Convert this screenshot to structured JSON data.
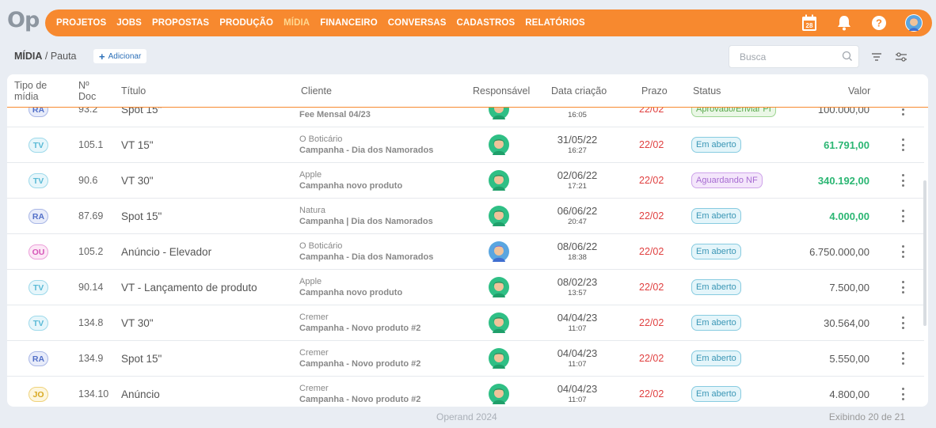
{
  "logo": "Op",
  "nav": {
    "items": [
      {
        "label": "PROJETOS",
        "active": false
      },
      {
        "label": "JOBS",
        "active": false
      },
      {
        "label": "PROPOSTAS",
        "active": false
      },
      {
        "label": "PRODUÇÃO",
        "active": false
      },
      {
        "label": "MÍDIA",
        "active": true
      },
      {
        "label": "FINANCEIRO",
        "active": false
      },
      {
        "label": "CONVERSAS",
        "active": false
      },
      {
        "label": "CADASTROS",
        "active": false
      },
      {
        "label": "RELATÓRIOS",
        "active": false
      }
    ],
    "calendar_day": "28",
    "accent": "#f7892f"
  },
  "breadcrumb": {
    "section": "MÍDIA",
    "separator": " / ",
    "page": "Pauta"
  },
  "add_button": "Adicionar",
  "search": {
    "placeholder": "Busca"
  },
  "table": {
    "headers": {
      "tipo_1": "Tipo de",
      "tipo_2": "mídia",
      "doc_1": "Nº",
      "doc_2": "Doc",
      "titulo": "Título",
      "cliente": "Cliente",
      "responsavel": "Responsável",
      "data": "Data criação",
      "prazo": "Prazo",
      "status": "Status",
      "valor": "Valor"
    },
    "rows": [
      {
        "type": "RA",
        "doc": "93.2",
        "title": "Spot 15\"",
        "client": "",
        "campaign": "Fee Mensal 04/23",
        "date": "",
        "time": "16:05",
        "prazo": "22/02",
        "status": "Aprovado/Enviar PI",
        "status_kind": "aprov",
        "value": "100.000,00",
        "green": false
      },
      {
        "type": "TV",
        "doc": "105.1",
        "title": "VT 15\"",
        "client": "O Boticário",
        "campaign": "Campanha - Dia dos Namorados",
        "date": "31/05/22",
        "time": "16:27",
        "prazo": "22/02",
        "status": "Em aberto",
        "status_kind": "aberto",
        "value": "61.791,00",
        "green": true
      },
      {
        "type": "TV",
        "doc": "90.6",
        "title": "VT 30\"",
        "client": "Apple",
        "campaign": "Campanha novo produto",
        "date": "02/06/22",
        "time": "17:21",
        "prazo": "22/02",
        "status": "Aguardando NF",
        "status_kind": "nf",
        "value": "340.192,00",
        "green": true
      },
      {
        "type": "RA",
        "doc": "87.69",
        "title": "Spot 15\"",
        "client": "Natura",
        "campaign": "Campanha | Dia dos Namorados",
        "date": "06/06/22",
        "time": "20:47",
        "prazo": "22/02",
        "status": "Em aberto",
        "status_kind": "aberto",
        "value": "4.000,00",
        "green": true
      },
      {
        "type": "OU",
        "doc": "105.2",
        "title": "Anúncio - Elevador",
        "client": "O Boticário",
        "campaign": "Campanha - Dia dos Namorados",
        "date": "08/06/22",
        "time": "18:38",
        "prazo": "22/02",
        "status": "Em aberto",
        "status_kind": "aberto",
        "value": "6.750.000,00",
        "green": false,
        "avatar": "blue"
      },
      {
        "type": "TV",
        "doc": "90.14",
        "title": "VT - Lançamento de produto",
        "client": "Apple",
        "campaign": "Campanha novo produto",
        "date": "08/02/23",
        "time": "13:57",
        "prazo": "22/02",
        "status": "Em aberto",
        "status_kind": "aberto",
        "value": "7.500,00",
        "green": false
      },
      {
        "type": "TV",
        "doc": "134.8",
        "title": "VT 30\"",
        "client": "Cremer",
        "campaign": "Campanha - Novo produto #2",
        "date": "04/04/23",
        "time": "11:07",
        "prazo": "22/02",
        "status": "Em aberto",
        "status_kind": "aberto",
        "value": "30.564,00",
        "green": false
      },
      {
        "type": "RA",
        "doc": "134.9",
        "title": "Spot 15\"",
        "client": "Cremer",
        "campaign": "Campanha - Novo produto #2",
        "date": "04/04/23",
        "time": "11:07",
        "prazo": "22/02",
        "status": "Em aberto",
        "status_kind": "aberto",
        "value": "5.550,00",
        "green": false
      },
      {
        "type": "JO",
        "doc": "134.10",
        "title": "Anúncio",
        "client": "Cremer",
        "campaign": "Campanha - Novo produto #2",
        "date": "04/04/23",
        "time": "11:07",
        "prazo": "22/02",
        "status": "Em aberto",
        "status_kind": "aberto",
        "value": "4.800,00",
        "green": false
      }
    ]
  },
  "footer": {
    "center": "Operand 2024",
    "right": "Exibindo 20 de 21"
  }
}
